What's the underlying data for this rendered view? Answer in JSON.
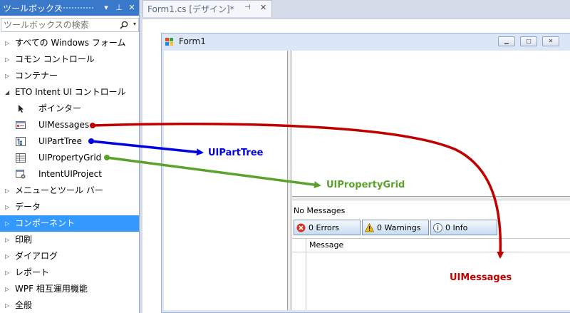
{
  "toolbox": {
    "title": "ツールボックス",
    "pin_glyph": "▾",
    "autohide_glyph": "⊥",
    "close_glyph": "✕",
    "search_placeholder": "ツールボックスの検索",
    "groups_top": [
      {
        "label": "すべての Windows フォーム",
        "arrow": "▷"
      },
      {
        "label": "コモン コントロール",
        "arrow": "▷"
      },
      {
        "label": "コンテナー",
        "arrow": "▷"
      },
      {
        "label": "ETO Intent UI コントロール",
        "arrow": "◢"
      }
    ],
    "tools": [
      {
        "label": "ポインター",
        "icon": "pointer-icon"
      },
      {
        "label": "UIMessages",
        "icon": "uimessages-icon"
      },
      {
        "label": "UIPartTree",
        "icon": "uiparttree-icon"
      },
      {
        "label": "UIPropertyGrid",
        "icon": "uipropertygrid-icon"
      },
      {
        "label": "IntentUIProject",
        "icon": "intentuiproject-icon"
      }
    ],
    "groups_bottom": [
      {
        "label": "メニューとツール バー",
        "arrow": "▷",
        "selected": false
      },
      {
        "label": "データ",
        "arrow": "▷",
        "selected": false
      },
      {
        "label": "コンポーネント",
        "arrow": "▷",
        "selected": true
      },
      {
        "label": "印刷",
        "arrow": "▷",
        "selected": false
      },
      {
        "label": "ダイアログ",
        "arrow": "▷",
        "selected": false
      },
      {
        "label": "レポート",
        "arrow": "▷",
        "selected": false
      },
      {
        "label": "WPF 相互運用機能",
        "arrow": "▷",
        "selected": false
      },
      {
        "label": "全般",
        "arrow": "▷",
        "selected": false
      }
    ]
  },
  "document_tab": {
    "label": "Form1.cs [デザイン]*",
    "pin_glyph": "⊣",
    "close_glyph": "✕"
  },
  "form": {
    "title": "Form1",
    "minimize_glyph": "▁",
    "maximize_glyph": "□",
    "close_glyph": "✕"
  },
  "messages": {
    "status": "No Messages",
    "errors_button": "0 Errors",
    "warnings_button": "0 Warnings",
    "info_button": "0 Info",
    "column_header": "Message"
  },
  "callouts": {
    "uiparttree": {
      "label": "UIPartTree",
      "color": "#0000e0"
    },
    "uipropertygrid": {
      "label": "UIPropertyGrid",
      "color": "#5ba22a"
    },
    "uimessages": {
      "label": "UIMessages",
      "color": "#c00000"
    }
  },
  "colors": {
    "toolbox_header": "#3a79c9",
    "selection": "#3399ff",
    "designer_bg": "#d6dbe9"
  }
}
